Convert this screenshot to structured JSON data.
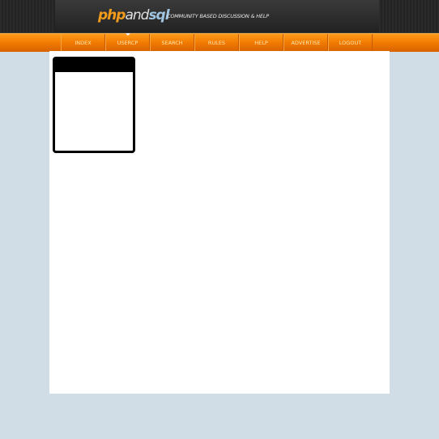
{
  "header": {
    "logo": {
      "part_php": "php",
      "part_and": "and",
      "part_sql": "sql"
    },
    "tagline": "COMMUNITY BASED DISCUSSION & HELP"
  },
  "nav": {
    "items": [
      {
        "label": "INDEX"
      },
      {
        "label": "USERCP"
      },
      {
        "label": "SEARCH"
      },
      {
        "label": "RULES"
      },
      {
        "label": "HELP"
      },
      {
        "label": "ADVERTISE"
      },
      {
        "label": "LOGOUT"
      }
    ],
    "active": "USERCP"
  },
  "colors": {
    "accent": "#f07a00",
    "background": "#d0dde6",
    "header": "#2a2a2a"
  }
}
